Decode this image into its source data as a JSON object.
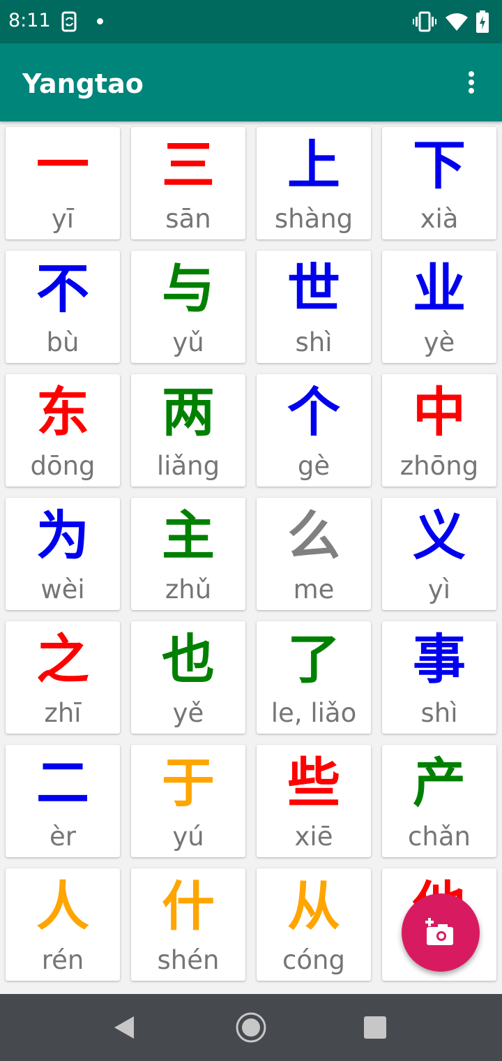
{
  "status_bar": {
    "time": "8:11",
    "icons": [
      "sync-icon",
      "notification-dot-icon",
      "vibrate-icon",
      "wifi-icon",
      "battery-icon"
    ]
  },
  "app_bar": {
    "title": "Yangtao",
    "menu_icon": "more-vert-icon"
  },
  "colors": {
    "red": "#ff0000",
    "blue": "#0000ee",
    "green": "#008000",
    "gray": "#808080",
    "orange": "#ffa500",
    "app_bar": "#00857a",
    "status_bar": "#016a5e",
    "fab": "#d81b60"
  },
  "characters": [
    {
      "hanzi": "一",
      "pinyin": "yī",
      "color": "red"
    },
    {
      "hanzi": "三",
      "pinyin": "sān",
      "color": "red"
    },
    {
      "hanzi": "上",
      "pinyin": "shàng",
      "color": "blue"
    },
    {
      "hanzi": "下",
      "pinyin": "xià",
      "color": "blue"
    },
    {
      "hanzi": "不",
      "pinyin": "bù",
      "color": "blue"
    },
    {
      "hanzi": "与",
      "pinyin": "yǔ",
      "color": "green"
    },
    {
      "hanzi": "世",
      "pinyin": "shì",
      "color": "blue"
    },
    {
      "hanzi": "业",
      "pinyin": "yè",
      "color": "blue"
    },
    {
      "hanzi": "东",
      "pinyin": "dōng",
      "color": "red"
    },
    {
      "hanzi": "两",
      "pinyin": "liǎng",
      "color": "green"
    },
    {
      "hanzi": "个",
      "pinyin": "gè",
      "color": "blue"
    },
    {
      "hanzi": "中",
      "pinyin": "zhōng",
      "color": "red"
    },
    {
      "hanzi": "为",
      "pinyin": "wèi",
      "color": "blue"
    },
    {
      "hanzi": "主",
      "pinyin": "zhǔ",
      "color": "green"
    },
    {
      "hanzi": "么",
      "pinyin": "me",
      "color": "gray"
    },
    {
      "hanzi": "义",
      "pinyin": "yì",
      "color": "blue"
    },
    {
      "hanzi": "之",
      "pinyin": "zhī",
      "color": "red"
    },
    {
      "hanzi": "也",
      "pinyin": "yě",
      "color": "green"
    },
    {
      "hanzi": "了",
      "pinyin": "le, liǎo",
      "color": "green"
    },
    {
      "hanzi": "事",
      "pinyin": "shì",
      "color": "blue"
    },
    {
      "hanzi": "二",
      "pinyin": "èr",
      "color": "blue"
    },
    {
      "hanzi": "于",
      "pinyin": "yú",
      "color": "orange"
    },
    {
      "hanzi": "些",
      "pinyin": "xiē",
      "color": "red"
    },
    {
      "hanzi": "产",
      "pinyin": "chǎn",
      "color": "green"
    },
    {
      "hanzi": "人",
      "pinyin": "rén",
      "color": "orange"
    },
    {
      "hanzi": "什",
      "pinyin": "shén",
      "color": "orange"
    },
    {
      "hanzi": "从",
      "pinyin": "cóng",
      "color": "orange"
    },
    {
      "hanzi": "他",
      "pinyin": "",
      "color": "red"
    }
  ],
  "fab": {
    "icon": "add-photo-icon"
  },
  "nav_bar": {
    "icons": [
      "back-icon",
      "home-icon",
      "recents-icon"
    ]
  }
}
